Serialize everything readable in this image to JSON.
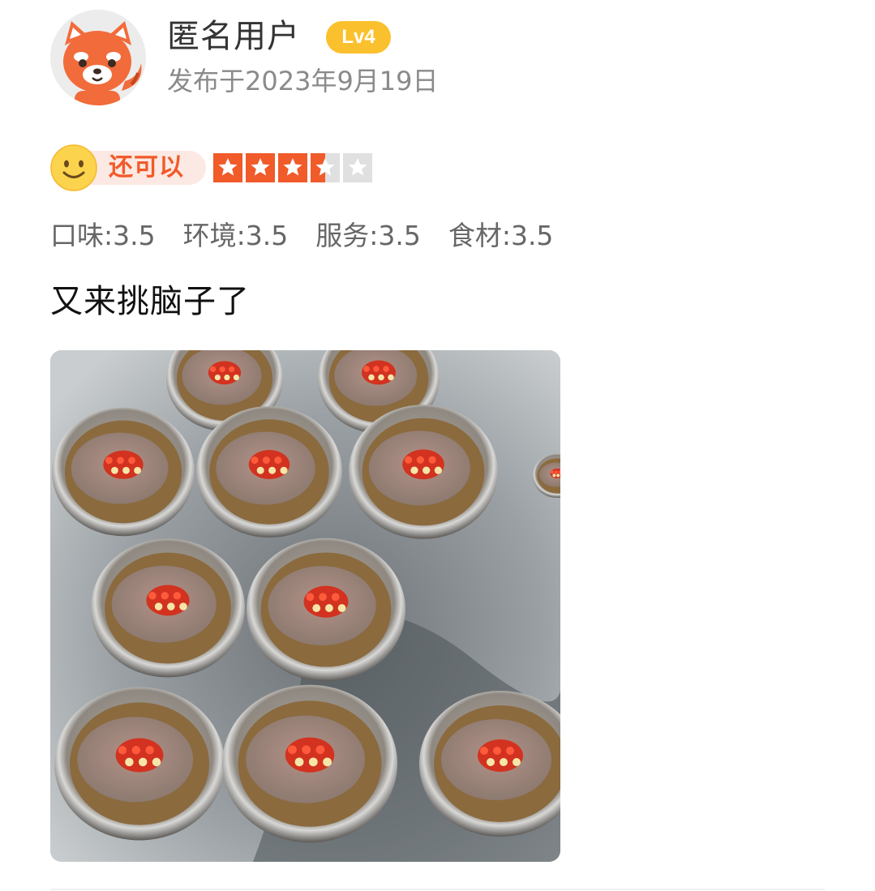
{
  "user": {
    "name": "匿名用户",
    "level": "Lv4",
    "avatar_icon": "red-panda-avatar-icon",
    "posted": "发布于2023年9月19日"
  },
  "rating": {
    "label": "还可以",
    "icon": "smile-face-icon",
    "stars_out_of_5": 3.5,
    "accent_color": "#f15a29"
  },
  "scores": [
    {
      "label": "口味:3.5"
    },
    {
      "label": "环境:3.5"
    },
    {
      "label": "服务:3.5"
    },
    {
      "label": "食材:3.5"
    }
  ],
  "review": {
    "text": "又来挑脑子了"
  },
  "photo": {
    "subject": "bowls-of-pig-brain-with-chili-icon"
  },
  "colors": {
    "level_badge": "#fbc02d",
    "star_filled": "#f15a29",
    "star_empty": "#e0e0e0",
    "muted_text": "#8a8a8a"
  }
}
